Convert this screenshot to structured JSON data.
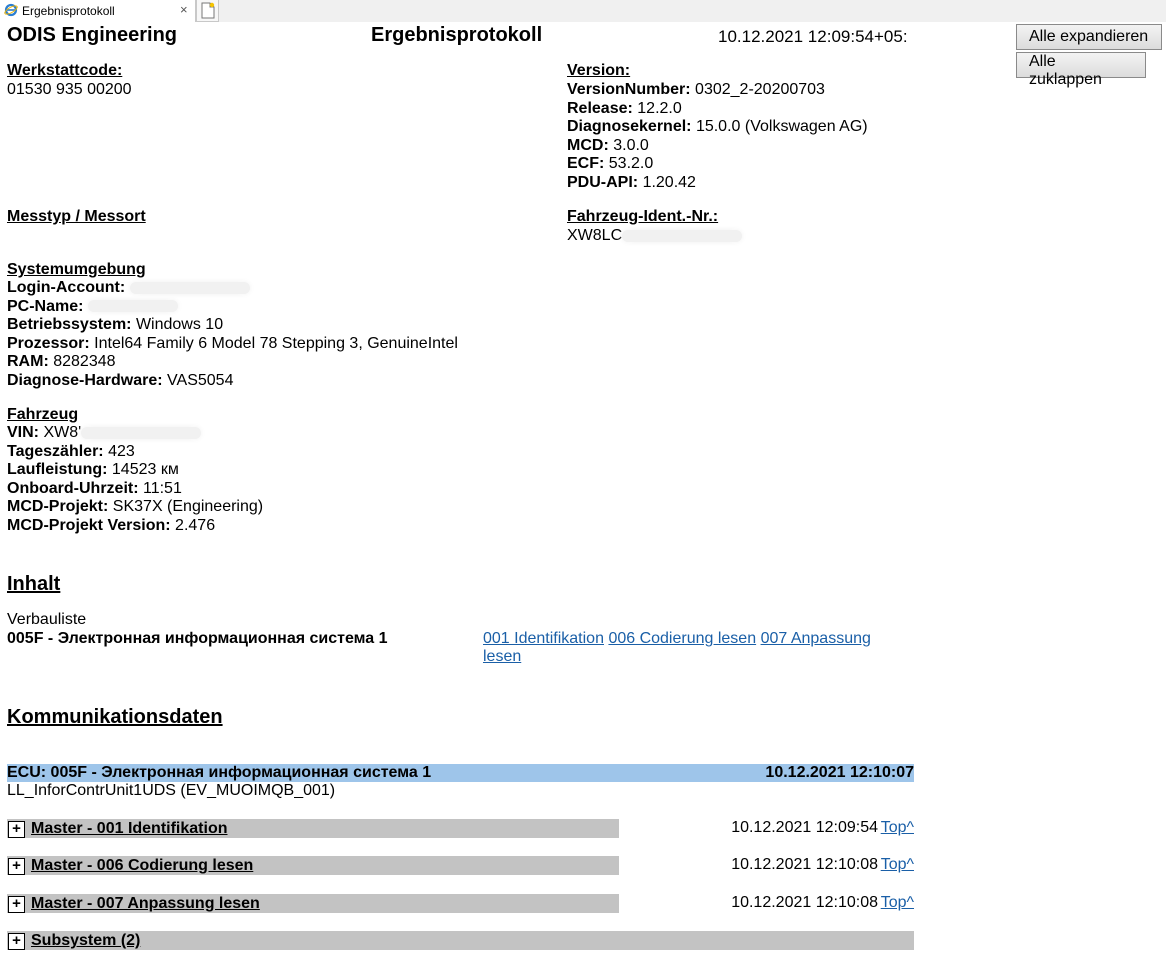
{
  "browser": {
    "tab_title": "Ergebnisprotokoll",
    "close_glyph": "×",
    "icon": "ie-icon"
  },
  "header": {
    "brand": "ODIS Engineering",
    "title": "Ergebnisprotokoll",
    "datetime": "10.12.2021 12:09:54+05:",
    "expand_all": "Alle expandieren",
    "collapse_all": "Alle zuklappen"
  },
  "werkstatt": {
    "label": "Werkstattcode:",
    "value": "01530 935 00200"
  },
  "version": {
    "label": "Version:",
    "rows": [
      {
        "k": "VersionNumber:",
        "v": "0302_2-20200703"
      },
      {
        "k": "Release:",
        "v": "12.2.0"
      },
      {
        "k": "Diagnosekernel:",
        "v": "15.0.0 (Volkswagen AG)"
      },
      {
        "k": "MCD:",
        "v": "3.0.0"
      },
      {
        "k": "ECF:",
        "v": "53.2.0"
      },
      {
        "k": "PDU-API:",
        "v": "1.20.42"
      }
    ]
  },
  "messtyp": {
    "label": "Messtyp / Messort"
  },
  "fin": {
    "label": "Fahrzeug-Ident.-Nr.:",
    "value": "XW8LC"
  },
  "system": {
    "label": "Systemumgebung",
    "rows": [
      {
        "k": "Login-Account:",
        "v": ""
      },
      {
        "k": "PC-Name:",
        "v": ""
      },
      {
        "k": "Betriebssystem:",
        "v": "Windows 10"
      },
      {
        "k": "Prozessor:",
        "v": "Intel64 Family 6 Model 78 Stepping 3, GenuineIntel"
      },
      {
        "k": "RAM:",
        "v": "8282348"
      },
      {
        "k": "Diagnose-Hardware:",
        "v": "VAS5054"
      }
    ]
  },
  "fahrzeug": {
    "label": "Fahrzeug",
    "rows": [
      {
        "k": "VIN:",
        "v": "XW8'"
      },
      {
        "k": "Tageszähler:",
        "v": "423"
      },
      {
        "k": "Laufleistung:",
        "v": "14523 км"
      },
      {
        "k": "Onboard-Uhrzeit:",
        "v": "11:51"
      },
      {
        "k": "MCD-Projekt:",
        "v": "SK37X (Engineering)"
      },
      {
        "k": "MCD-Projekt Version:",
        "v": "2.476"
      }
    ]
  },
  "inhalt": {
    "heading": "Inhalt",
    "verbauliste": "Verbauliste",
    "ecu_name": "005F - Электронная информационная система 1",
    "links": [
      "001 Identifikation",
      "006 Codierung lesen",
      "007 Anpassung",
      "lesen"
    ]
  },
  "komm": {
    "heading": "Kommunikationsdaten",
    "ecu_title": "ECU: 005F - Электронная информационная система 1",
    "ecu_time": "10.12.2021 12:10:07",
    "ecu_sub": "LL_InforContrUnit1UDS (EV_MUOIMQB_001)",
    "expand_glyph": "+",
    "sections": [
      {
        "label": "Master - 001 Identifikation",
        "time": "10.12.2021 12:09:54",
        "top": "Top^"
      },
      {
        "label": "Master - 006 Codierung lesen",
        "time": "10.12.2021 12:10:08",
        "top": "Top^"
      },
      {
        "label": "Master - 007 Anpassung lesen",
        "time": "10.12.2021 12:10:08",
        "top": "Top^"
      },
      {
        "label": "Subsystem (2)",
        "time": "",
        "top": ""
      }
    ]
  }
}
